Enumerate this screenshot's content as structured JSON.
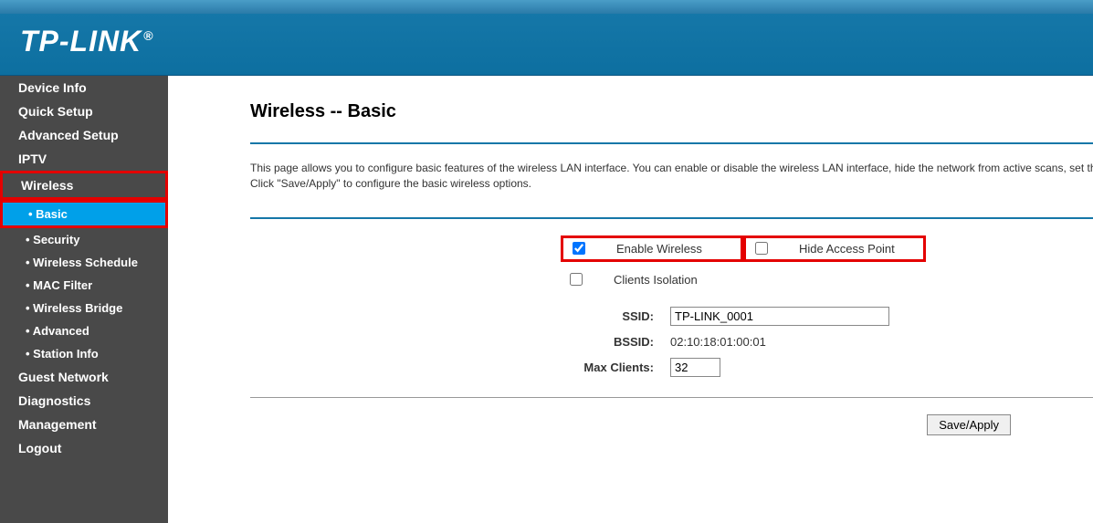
{
  "logo": "TP-LINK",
  "sidebar": {
    "items": [
      {
        "label": "Device Info",
        "sub": false,
        "active": false,
        "highlight": false
      },
      {
        "label": "Quick Setup",
        "sub": false,
        "active": false,
        "highlight": false
      },
      {
        "label": "Advanced Setup",
        "sub": false,
        "active": false,
        "highlight": false
      },
      {
        "label": "IPTV",
        "sub": false,
        "active": false,
        "highlight": false
      },
      {
        "label": "Wireless",
        "sub": false,
        "active": false,
        "highlight": true
      },
      {
        "label": "Basic",
        "sub": true,
        "active": true,
        "highlight": true
      },
      {
        "label": "Security",
        "sub": true,
        "active": false,
        "highlight": false
      },
      {
        "label": "Wireless Schedule",
        "sub": true,
        "active": false,
        "highlight": false
      },
      {
        "label": "MAC Filter",
        "sub": true,
        "active": false,
        "highlight": false
      },
      {
        "label": "Wireless Bridge",
        "sub": true,
        "active": false,
        "highlight": false
      },
      {
        "label": "Advanced",
        "sub": true,
        "active": false,
        "highlight": false
      },
      {
        "label": "Station Info",
        "sub": true,
        "active": false,
        "highlight": false
      },
      {
        "label": "Guest Network",
        "sub": false,
        "active": false,
        "highlight": false
      },
      {
        "label": "Diagnostics",
        "sub": false,
        "active": false,
        "highlight": false
      },
      {
        "label": "Management",
        "sub": false,
        "active": false,
        "highlight": false
      },
      {
        "label": "Logout",
        "sub": false,
        "active": false,
        "highlight": false
      }
    ]
  },
  "main": {
    "title": "Wireless -- Basic",
    "description": "This page allows you to configure basic features of the wireless LAN interface. You can enable or disable the wireless LAN interface, hide the network from active scans, set th\nClick \"Save/Apply\" to configure the basic wireless options.",
    "checkboxes": [
      {
        "label": "Enable Wireless",
        "checked": true,
        "highlight": true
      },
      {
        "label": "Hide Access Point",
        "checked": false,
        "highlight": true
      },
      {
        "label": "Clients Isolation",
        "checked": false,
        "highlight": false
      }
    ],
    "fields": {
      "ssid_label": "SSID:",
      "ssid_value": "TP-LINK_0001",
      "bssid_label": "BSSID:",
      "bssid_value": "02:10:18:01:00:01",
      "max_label": "Max Clients:",
      "max_value": "32"
    },
    "button": "Save/Apply"
  }
}
